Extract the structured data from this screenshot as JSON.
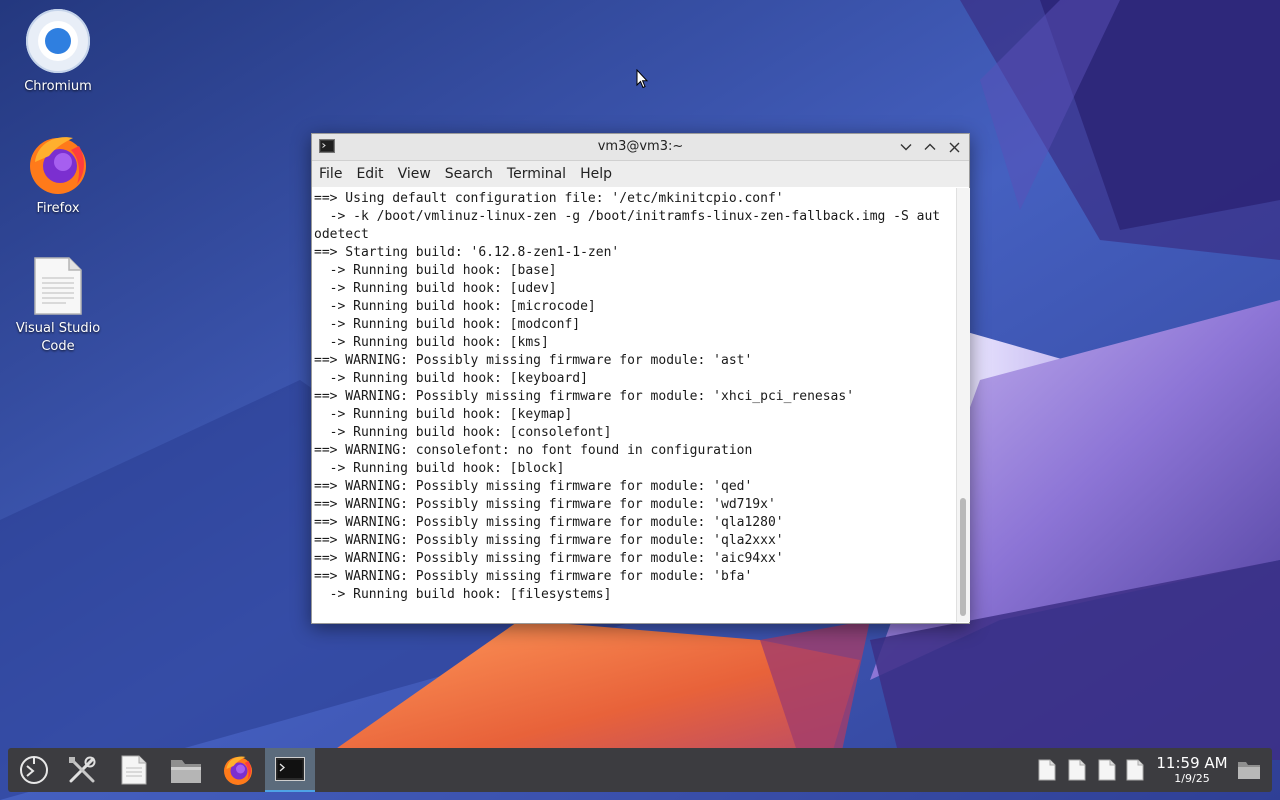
{
  "desktop": {
    "icons": [
      {
        "label": "Chromium",
        "icon": "chromium-icon"
      },
      {
        "label": "Firefox",
        "icon": "firefox-icon"
      },
      {
        "label": "Visual Studio Code",
        "icon": "document-icon"
      }
    ]
  },
  "terminal": {
    "title": "vm3@vm3:~",
    "menu": [
      "File",
      "Edit",
      "View",
      "Search",
      "Terminal",
      "Help"
    ],
    "output": "==> Using default configuration file: '/etc/mkinitcpio.conf'\n  -> -k /boot/vmlinuz-linux-zen -g /boot/initramfs-linux-zen-fallback.img -S aut\nodetect\n==> Starting build: '6.12.8-zen1-1-zen'\n  -> Running build hook: [base]\n  -> Running build hook: [udev]\n  -> Running build hook: [microcode]\n  -> Running build hook: [modconf]\n  -> Running build hook: [kms]\n==> WARNING: Possibly missing firmware for module: 'ast'\n  -> Running build hook: [keyboard]\n==> WARNING: Possibly missing firmware for module: 'xhci_pci_renesas'\n  -> Running build hook: [keymap]\n  -> Running build hook: [consolefont]\n==> WARNING: consolefont: no font found in configuration\n  -> Running build hook: [block]\n==> WARNING: Possibly missing firmware for module: 'qed'\n==> WARNING: Possibly missing firmware for module: 'wd719x'\n==> WARNING: Possibly missing firmware for module: 'qla1280'\n==> WARNING: Possibly missing firmware for module: 'qla2xxx'\n==> WARNING: Possibly missing firmware for module: 'aic94xx'\n==> WARNING: Possibly missing firmware for module: 'bfa'\n  -> Running build hook: [filesystems]"
  },
  "taskbar": {
    "launchers": [
      "application-menu-icon",
      "settings-tools-icon",
      "text-editor-icon",
      "file-manager-icon",
      "firefox-icon",
      "terminal-icon"
    ],
    "active": "terminal-icon",
    "tray_items": [
      "document-icon",
      "document-icon",
      "document-icon",
      "document-icon"
    ],
    "clock": {
      "time": "11:59 AM",
      "date": "1/9/25"
    },
    "show_desktop": "folder-icon"
  },
  "colors": {
    "taskbar_bg": "#3c3c40",
    "active_task": "#5b6b7c",
    "accent": "#4ea3e6"
  }
}
